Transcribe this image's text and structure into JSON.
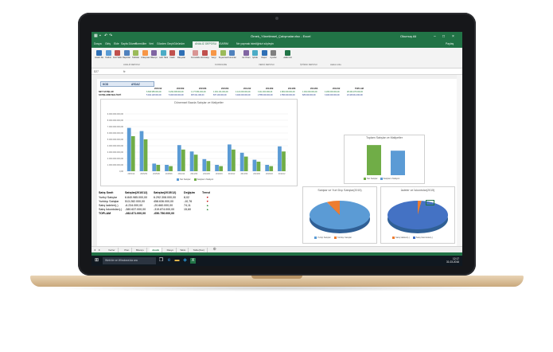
{
  "window": {
    "title": "Örnek_Yönetimsel_Çalışmalar.xlsx - Excel",
    "user": "Okumuş Ali",
    "share": "Paylaş"
  },
  "ribbon": {
    "tabs": [
      "Dosya",
      "Giriş",
      "Ekle",
      "Sayfa Düzeni",
      "Formüller",
      "Veri",
      "Gözden Geçir",
      "Görünüm",
      "ANALİZ DEPOSU",
      "TASARIM"
    ],
    "active_tab": "ANALİZ DEPOSU",
    "tellme": "Ne yapmak istediğinizi söyleyin",
    "groups": [
      "ANALİZ DEPOSU",
      "KONSOLİDE",
      "VERGİ DEPOSU",
      "İŞTİRAK DEPOSU",
      "Hakkımızda"
    ],
    "buttons": [
      {
        "label": "Analiz Deposu",
        "color": "#2e6fb5"
      },
      {
        "label": "Yardım",
        "color": "#5a9bd4"
      },
      {
        "label": "Kod Tablosu",
        "color": "#c0504d"
      },
      {
        "label": "Raporlar",
        "color": "#4f81bd"
      },
      {
        "label": "Tablolar",
        "color": "#9bbb59"
      },
      {
        "label": "Özkaynak",
        "color": "#f79646"
      },
      {
        "label": "Bilanço",
        "color": "#8064a2"
      },
      {
        "label": "Gelir Tablosu",
        "color": "#4bacc6"
      },
      {
        "label": "Nakit",
        "color": "#c0504d"
      },
      {
        "label": "Rasyolar",
        "color": "#2e6fb5"
      },
      {
        "label": "Konsolide",
        "color": "#d99594"
      },
      {
        "label": "Eliminasyon",
        "color": "#c0504d"
      },
      {
        "label": "Vergi",
        "color": "#f79646"
      },
      {
        "label": "Beyanname",
        "color": "#9bbb59"
      },
      {
        "label": "Kurumlar",
        "color": "#4f81bd"
      },
      {
        "label": "Kat Oranı",
        "color": "#8064a2"
      },
      {
        "label": "İştirak",
        "color": "#4bacc6"
      },
      {
        "label": "Rapor",
        "color": "#2e6fb5"
      },
      {
        "label": "Ayarlar",
        "color": "#7f7f7f"
      },
      {
        "label": "Hakkımızda",
        "color": "#217346"
      }
    ]
  },
  "formula": {
    "namebox": "D27",
    "fx": "fx"
  },
  "sheet": {
    "kod_label": "KOD",
    "kod_value": "AYDAZ",
    "period_headers": [
      "2015/12",
      "2015/09",
      "2015/06",
      "2015/03",
      "2014/12",
      "2014/09",
      "2014/06",
      "2014/03",
      "2013/12",
      "TOPLAM"
    ],
    "rows": [
      {
        "label": "NET SATIŞLAR",
        "values": [
          "6.840.985.000,00",
          "6.292.308.000,00",
          "1.177.891.000,00",
          "1.001.131.000,00",
          "4.121.000.000,00",
          "3.111.000.000,00",
          "1.881.000.000,00",
          "1.001.000.000,00",
          "4.200.000.000,00",
          "28.432.276.000,00"
        ]
      },
      {
        "label": "SATIŞLARIN MALİYETİ",
        "values": [
          "5.492.128.000,00",
          "5.003.000.000,00",
          "997.011.000,00",
          "837.100.000,00",
          "3.400.000.000,00",
          "2.555.000.000,00",
          "1.556.000.000,00",
          "825.000.000,00",
          "3.400.000.000,00",
          "23.108.911.000,00"
        ]
      }
    ]
  },
  "summary": {
    "headers": [
      "Satış Sınıfı",
      "Satışlar(2016/12)",
      "Satışlar(2015/12)",
      "Değişim",
      "Trend"
    ],
    "rows": [
      {
        "name": "Yurtiçi Satışlar",
        "a": "6.840.985.000,00",
        "b": "6.292.308.000,00",
        "c": "8,02",
        "trend": "down"
      },
      {
        "name": "Yurtdışı Satışlar",
        "a": "513.282.000,00",
        "b": "458.636.000,00",
        "c": "-10,76",
        "trend": "down"
      },
      {
        "name": "Satış İadeleri(-)",
        "a": "-6.234.000,00",
        "b": "-20.660.000,00",
        "c": "74,11",
        "trend": "up"
      },
      {
        "name": "Satış İskontoları(-)",
        "a": "-380.637.000,00",
        "b": "-319.874.000,00",
        "c": "15,60",
        "trend": "up"
      },
      {
        "name": "TOPLAM",
        "a": "-282.871.000,00",
        "b": "-650.756.000,00",
        "c": "",
        "trend": ""
      }
    ]
  },
  "charts": {
    "bar_title": "Dönemsel Bazda Satışlar ve Maliyetler",
    "bar_legend": [
      "Net Satışlar",
      "Satışların Maliyeti"
    ],
    "bar_yticks": [
      "9.000.000.000,00",
      "8.000.000.000,00",
      "7.000.000.000,00",
      "6.000.000.000,00",
      "5.000.000.000,00",
      "4.000.000.000,00",
      "3.000.000.000,00",
      "2.000.000.000,00",
      "1.000.000.000,00",
      "0,00"
    ],
    "bar_categories": [
      "2015/12",
      "2015/09",
      "2015/06",
      "2015/03",
      "2014/12",
      "2014/09",
      "2014/06",
      "2014/03",
      "2013/12",
      "2013/09",
      "2013/06",
      "2013/03",
      "2012/12"
    ],
    "bar_series": [
      {
        "name": "Net Satışlar",
        "color": "#5b9bd5",
        "values": [
          6.8,
          6.3,
          1.2,
          1.0,
          4.1,
          3.1,
          1.9,
          1.0,
          4.2,
          2.9,
          1.8,
          1.0,
          3.9
        ]
      },
      {
        "name": "Satışların Maliyeti",
        "color": "#70ad47",
        "values": [
          5.5,
          5.0,
          1.0,
          0.8,
          3.4,
          2.6,
          1.6,
          0.8,
          3.4,
          2.3,
          1.5,
          0.8,
          3.1
        ]
      }
    ],
    "total_title": "Toplam Satışlar ve Maliyetler",
    "total_legend": [
      "Net Satışlar",
      "Satışların Maliyeti"
    ],
    "total_values": [
      28.4,
      23.1
    ],
    "pie1_title": "Satışlar ve Yurt Dışı Satışlar(2015)",
    "pie1_legend": [
      "Yurtiçi Satışlar",
      "Yurtdışı Satışlar"
    ],
    "pie1_values": [
      93,
      7
    ],
    "pie2_title": "İadeler ve İskontolar(2015)",
    "pie2_legend": [
      "Satış İadeleri(-)",
      "Satış İskontoları(-)"
    ],
    "pie2_values": [
      2,
      98
    ],
    "b1_title": "Dönemlere Göre Satışlar",
    "b1_label": "NET SATIŞLAR",
    "b2_title": "Net Dönem Kar/Zararı",
    "b3_title": "Özkaynaklar"
  },
  "sheet_tabs": [
    "Veriler",
    "Plan",
    "Bilanço",
    "Analiz",
    "Rasyo",
    "Tablo",
    "Tablo(Son)"
  ],
  "active_sheet": "Analiz",
  "taskbar": {
    "search": "Web'de ve Windows'da ara",
    "time": "12:17",
    "date": "31.03.2016"
  }
}
